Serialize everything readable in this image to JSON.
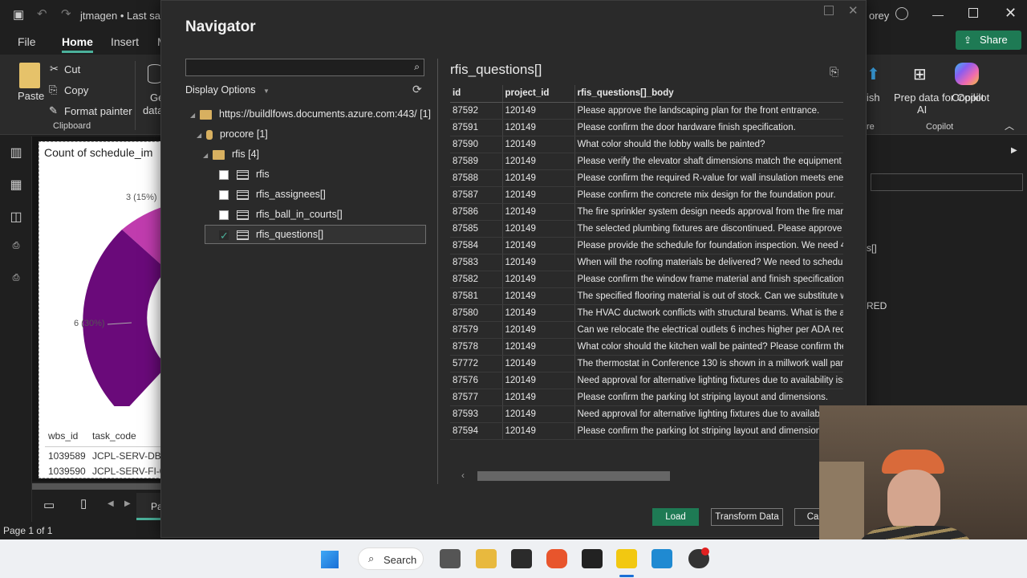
{
  "app": {
    "title": "jtmagen • Last save",
    "user": "orey",
    "undo_label": "↶",
    "redo_label": "↷"
  },
  "ribbon_tabs": [
    "File",
    "Home",
    "Insert",
    "M"
  ],
  "ribbon": {
    "paste": "Paste",
    "cut": "Cut",
    "copy": "Copy",
    "format_painter": "Format painter",
    "clipboard_group": "Clipboard",
    "get_data_1": "Ge",
    "get_data_2": "data",
    "ish": "ish",
    "re": "re",
    "prep_data_1": "Prep data for Copilot",
    "prep_data_2": "AI",
    "copilot": "Copilot",
    "copilot_group": "Copilot",
    "share": "Share"
  },
  "canvas": {
    "visual_title": "Count of schedule_im",
    "label_top": "3 (15%)",
    "label_left": "6 (30%)",
    "col_wbs": "wbs_id",
    "col_task": "task_code",
    "rows": [
      {
        "wbs": "1039589",
        "task": "JCPL-SERV-DBI-"
      },
      {
        "wbs": "1039590",
        "task": "JCPL-SERV-FI-01"
      }
    ],
    "page_tab": "Pa"
  },
  "right_pane": {
    "fields_item": "s[]",
    "red_text": "RED"
  },
  "status": {
    "page": "Page 1 of 1"
  },
  "taskbar": {
    "search": "Search"
  },
  "navigator": {
    "title": "Navigator",
    "search_value": "",
    "display_options": "Display Options",
    "tree": [
      {
        "label": "https://buildlfows.documents.azure.com:443/ [1]",
        "kind": "folder"
      },
      {
        "label": "procore [1]",
        "kind": "db"
      },
      {
        "label": "rfis [4]",
        "kind": "folder"
      },
      {
        "label": "rfis",
        "kind": "table",
        "checked": false
      },
      {
        "label": "rfis_assignees[]",
        "kind": "table",
        "checked": false
      },
      {
        "label": "rfis_ball_in_courts[]",
        "kind": "table",
        "checked": false
      },
      {
        "label": "rfis_questions[]",
        "kind": "table",
        "checked": true
      }
    ],
    "preview_title": "rfis_questions[]",
    "columns": [
      "id",
      "project_id",
      "rfis_questions[]_body"
    ],
    "rows": [
      [
        "87592",
        "120149",
        "Please approve the landscaping plan for the front entrance."
      ],
      [
        "87591",
        "120149",
        "Please confirm the door hardware finish specification."
      ],
      [
        "87590",
        "120149",
        "What color should the lobby walls be painted?"
      ],
      [
        "87589",
        "120149",
        "Please verify the elevator shaft dimensions match the equipment sp"
      ],
      [
        "87588",
        "120149",
        "Please confirm the required R-value for wall insulation meets energy"
      ],
      [
        "87587",
        "120149",
        "Please confirm the concrete mix design for the foundation pour."
      ],
      [
        "87586",
        "120149",
        "The fire sprinkler system design needs approval from the fire marsha"
      ],
      [
        "87585",
        "120149",
        "The selected plumbing fixtures are discontinued. Please approve alt"
      ],
      [
        "87584",
        "120149",
        "Please provide the schedule for foundation inspection. We need 48 h"
      ],
      [
        "87583",
        "120149",
        "When will the roofing materials be delivered? We need to schedule c"
      ],
      [
        "87582",
        "120149",
        "Please confirm the window frame material and finish specifications."
      ],
      [
        "87581",
        "120149",
        "The specified flooring material is out of stock. Can we substitute wit"
      ],
      [
        "87580",
        "120149",
        "The HVAC ductwork conflicts with structural beams. What is the app"
      ],
      [
        "87579",
        "120149",
        "Can we relocate the electrical outlets 6 inches higher per ADA requir"
      ],
      [
        "87578",
        "120149",
        "What color should the kitchen wall be painted? Please confirm the e"
      ],
      [
        "57772",
        "120149",
        "The thermostat in Conference 130 is shown in a millwork wall panel."
      ],
      [
        "87576",
        "120149",
        "Need approval for alternative lighting fixtures due to availability issu"
      ],
      [
        "87577",
        "120149",
        "Please confirm the parking lot striping layout and dimensions."
      ],
      [
        "87593",
        "120149",
        "Need approval for alternative lighting fixtures due to availabilit"
      ],
      [
        "87594",
        "120149",
        "Please confirm the parking lot striping layout and dimensions."
      ]
    ],
    "buttons": {
      "load": "Load",
      "transform": "Transform Data",
      "cancel": "Car"
    }
  },
  "colors": {
    "accent": "#4bb19b",
    "load_button": "#1e7a54",
    "donut_dark": "#6a0a7a",
    "donut_pink": "#c03cae"
  }
}
